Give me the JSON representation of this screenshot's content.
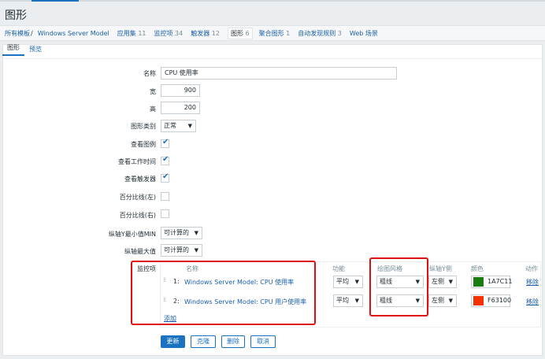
{
  "page_title": "图形",
  "breadcrumb": {
    "root": "所有模板",
    "separator": "/",
    "host": "Windows Server Model",
    "items": [
      {
        "label": "应用集",
        "count": "11"
      },
      {
        "label": "监控项",
        "count": "34"
      },
      {
        "label": "触发器",
        "count": "12"
      },
      {
        "label": "图形",
        "count": "6",
        "selected": true
      },
      {
        "label": "聚合图形",
        "count": "1"
      },
      {
        "label": "自动发现规则",
        "count": "3"
      },
      {
        "label": "Web 场景",
        "count": ""
      }
    ]
  },
  "tabs": [
    {
      "label": "图形",
      "active": true
    },
    {
      "label": "预览",
      "active": false
    }
  ],
  "form": {
    "name_label": "名称",
    "name_value": "CPU 使用率",
    "width_label": "宽",
    "width_value": "900",
    "height_label": "高",
    "height_value": "200",
    "graph_type_label": "图形类别",
    "graph_type_value": "正常",
    "show_legend_label": "查看图例",
    "show_work_period_label": "查看工作时间",
    "show_triggers_label": "查看触发器",
    "percentile_left_label": "百分比线(左)",
    "percentile_right_label": "百分比线(右)",
    "ymin_label": "纵轴Y最小值MIN",
    "ymin_value": "可计算的",
    "ymax_label": "纵轴最大值",
    "ymax_value": "可计算的",
    "items_label": "监控项"
  },
  "items_table": {
    "headers": {
      "name": "名称",
      "function": "功能",
      "draw_style": "绘图风格",
      "y_axis": "纵轴Y侧",
      "color": "颜色",
      "action": "动作"
    },
    "rows": [
      {
        "num": "1:",
        "name": "Windows Server Model: CPU 使用率",
        "function": "平均",
        "draw_style": "粗线",
        "y_axis": "左侧",
        "color": "1A7C11",
        "color_hex": "#1A7C11",
        "action": "移除"
      },
      {
        "num": "2:",
        "name": "Windows Server Model: CPU 用户使用率",
        "function": "平均",
        "draw_style": "粗线",
        "y_axis": "左侧",
        "color": "F63100",
        "color_hex": "#F63100",
        "action": "移除"
      }
    ],
    "add_label": "添加"
  },
  "buttons": {
    "update": "更新",
    "clone": "克隆",
    "delete": "删除",
    "cancel": "取消"
  },
  "colors": {
    "accent": "#1a72c0",
    "link": "#1a5fa8",
    "highlight": "#e01010"
  }
}
